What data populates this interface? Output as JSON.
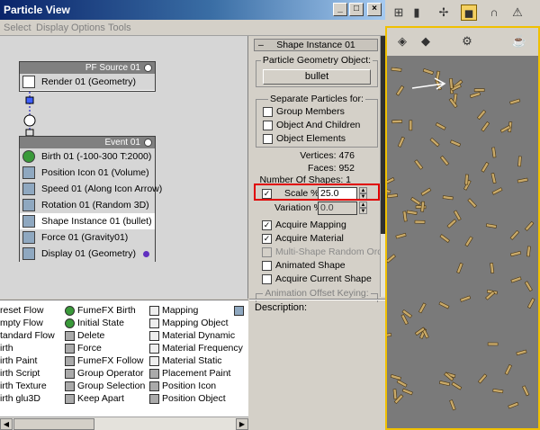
{
  "window": {
    "title": "Particle View",
    "controls": {
      "minimize": "_",
      "maximize": "□",
      "close": "×"
    }
  },
  "menu": [
    "Select",
    "Display",
    "Options",
    "Tools"
  ],
  "flow": {
    "source": {
      "title": "PF Source 01",
      "operator": "Render 01 (Geometry)"
    },
    "event": {
      "title": "Event 01",
      "operators": [
        "Birth 01 (-100-300 T:2000)",
        "Position Icon 01 (Volume)",
        "Speed 01 (Along Icon Arrow)",
        "Rotation 01 (Random 3D)",
        "Shape Instance 01 (bullet)",
        "Force 01 (Gravity01)",
        "Display 01 (Geometry)"
      ],
      "selected_index": 4,
      "display_color": "#6030c0"
    }
  },
  "depot": {
    "col0": [
      "reset Flow",
      "mpty Flow",
      "tandard Flow",
      "irth",
      "irth Paint",
      "irth Script",
      "irth Texture",
      "irth glu3D"
    ],
    "col1": [
      "FumeFX Birth",
      "Initial State",
      "Delete",
      "Force",
      "FumeFX Follow",
      "Group Operator",
      "Group Selection",
      "Keep Apart"
    ],
    "col2": [
      "Mapping",
      "Mapping Object",
      "Material Dynamic",
      "Material Frequency",
      "Material Static",
      "Placement Paint",
      "Position Icon",
      "Position Object"
    ]
  },
  "rollout": {
    "title": "Shape Instance 01",
    "geometry_group": "Particle Geometry Object:",
    "geometry_button": "bullet",
    "separate_group": "Separate Particles for:",
    "separate": [
      {
        "label": "Group Members",
        "checked": false
      },
      {
        "label": "Object And Children",
        "checked": false
      },
      {
        "label": "Object Elements",
        "checked": false
      }
    ],
    "vertices_label": "Vertices:",
    "vertices": "476",
    "faces_label": "Faces:",
    "faces": "952",
    "shapes_label": "Number Of Shapes:",
    "shapes": "1",
    "scale_label": "Scale %",
    "scale_value": "25.0",
    "scale_checked": true,
    "variation_label": "Variation %",
    "variation_value": "0.0",
    "options": [
      {
        "label": "Acquire Mapping",
        "checked": true,
        "disabled": false
      },
      {
        "label": "Acquire Material",
        "checked": true,
        "disabled": false
      },
      {
        "label": "Multi-Shape Random Order",
        "checked": false,
        "disabled": true
      },
      {
        "label": "Animated Shape",
        "checked": false,
        "disabled": false
      },
      {
        "label": "Acquire Current Shape",
        "checked": false,
        "disabled": false
      }
    ],
    "anim_group": "Animation Offset Keying:",
    "description_label": "Description:"
  },
  "viewport": {
    "toolbar_icons": [
      "hierarchy-icon",
      "select-link-icon",
      "move-icon",
      "create-box-icon",
      "magnet-icon",
      "snap-icon"
    ],
    "toolbar2_icons": [
      "bind-icon",
      "space-warp-icon",
      "wrench-icon",
      "teapot-icon"
    ],
    "active_color": "#f0c000"
  }
}
